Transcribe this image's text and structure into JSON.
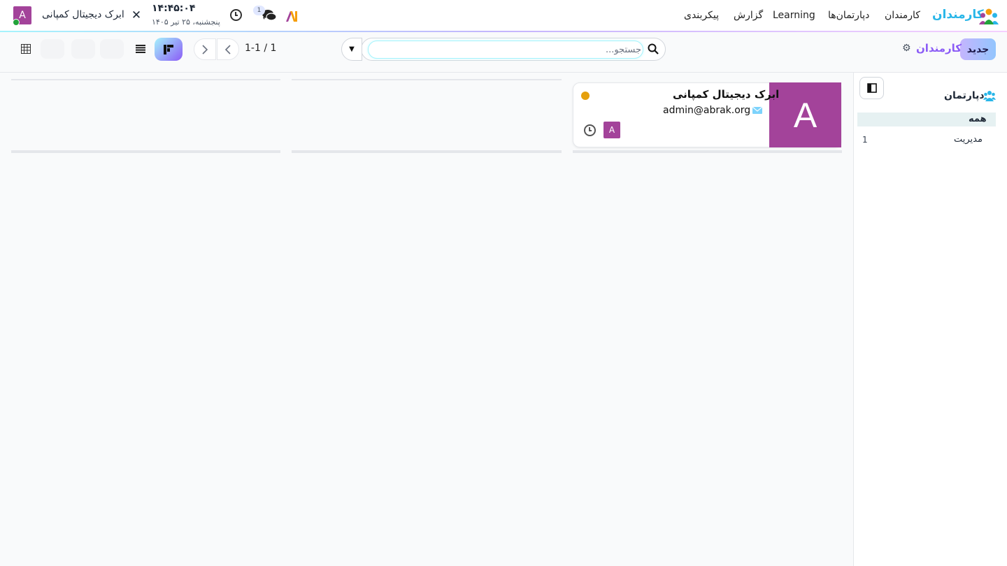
{
  "navbar": {
    "user_initial": "A",
    "company_name": "ابرک دیجیتال کمپانی",
    "clock_time": "۱۴:۴۵:۰۴",
    "clock_date": "پنجشنبه، ۲۵ تیر ۱۴۰۵",
    "messages_badge": "1",
    "app_title": "کارمندان",
    "menu": [
      "کارمندان",
      "دپارتمان‌ها",
      "Learning",
      "گزارش",
      "پیکربندی"
    ],
    "icons": [
      "tools-icon",
      "activity-clock-icon",
      "chat-icon",
      "ai-icon",
      "app-logo-icon"
    ]
  },
  "control_panel": {
    "new_label": "جدید",
    "breadcrumb": "کارمندان",
    "search_placeholder": "جستجو...",
    "pager_value": "1-1 / 1",
    "views": [
      "kanban",
      "list",
      "pivot"
    ]
  },
  "side_panel": {
    "title": "دپارتمان",
    "items": [
      {
        "label": "همه",
        "count": "",
        "active": true
      },
      {
        "label": "مدیریت",
        "count": "1",
        "active": false
      }
    ]
  },
  "kanban": {
    "cards": [
      {
        "name": "ابرک دیجیتال کمپانی",
        "email": "admin@abrak.org",
        "image_initial": "A",
        "user_initial": "A",
        "status_color": "#e5a00d",
        "avatar_color": "#a3439a"
      }
    ]
  },
  "colors": {
    "accent_purple": "#8b5cf6",
    "accent_cyan": "#29b6e8",
    "avatar": "#a3439a",
    "online": "#22a33a"
  }
}
